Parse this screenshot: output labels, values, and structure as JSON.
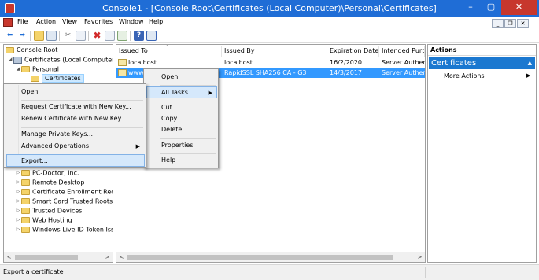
{
  "window": {
    "title": "Console1 - [Console Root\\Certificates (Local Computer)\\Personal\\Certificates]",
    "minimize": "–",
    "maximize": "▢",
    "close": "✕"
  },
  "menubar": {
    "items": [
      "File",
      "Action",
      "View",
      "Favorites",
      "Window",
      "Help"
    ],
    "mdi_buttons": [
      "_",
      "❐",
      "✕"
    ]
  },
  "tree": {
    "items": [
      {
        "label": "Console Root"
      },
      {
        "label": "Certificates (Local Computer)",
        "expander": "◢"
      },
      {
        "label": "Personal",
        "expander": "◢"
      },
      {
        "label": "Certificates"
      },
      {
        "label": "PC-Doctor, Inc.",
        "expander": "▷"
      },
      {
        "label": "Remote Desktop",
        "expander": "▷"
      },
      {
        "label": "Certificate Enrollment Requ",
        "expander": "▷"
      },
      {
        "label": "Smart Card Trusted Roots",
        "expander": "▷"
      },
      {
        "label": "Trusted Devices",
        "expander": "▷"
      },
      {
        "label": "Web Hosting",
        "expander": "▷"
      },
      {
        "label": "Windows Live ID Token Iss",
        "expander": "▷"
      }
    ]
  },
  "list": {
    "columns": [
      "Issued To",
      "Issued By",
      "Expiration Date",
      "Intended Purpo"
    ],
    "rows": [
      {
        "issued_to": "localhost",
        "issued_by": "localhost",
        "expiration": "16/2/2020",
        "purpose": "Server Authenti"
      },
      {
        "issued_to": "www.",
        "issued_by": "RapidSSL SHA256 CA - G3",
        "expiration": "14/3/2017",
        "purpose": "Server Authenti"
      }
    ]
  },
  "actions": {
    "title": "Actions",
    "section": "Certificates",
    "section_arrow": "▲",
    "more": "More Actions",
    "more_arrow": "▶"
  },
  "context_menu": {
    "items": [
      {
        "label": "Open"
      },
      {
        "label": "All Tasks",
        "submenu_arrow": "▶"
      },
      {
        "label": "Cut"
      },
      {
        "label": "Copy"
      },
      {
        "label": "Delete"
      },
      {
        "label": "Properties"
      },
      {
        "label": "Help"
      }
    ]
  },
  "submenu": {
    "items": [
      {
        "label": "Open"
      },
      {
        "label": "Request Certificate with New Key..."
      },
      {
        "label": "Renew Certificate with New Key..."
      },
      {
        "label": "Manage Private Keys..."
      },
      {
        "label": "Advanced Operations",
        "submenu_arrow": "▶"
      },
      {
        "label": "Export..."
      }
    ]
  },
  "scroll_arrows": {
    "left": "<",
    "right": ">"
  },
  "status": {
    "text": "Export a certificate"
  },
  "colors": {
    "titlebar": "#1f6dd6",
    "selection": "#3399ff",
    "actions_header": "#1b78d0",
    "close_button": "#c7372d"
  }
}
